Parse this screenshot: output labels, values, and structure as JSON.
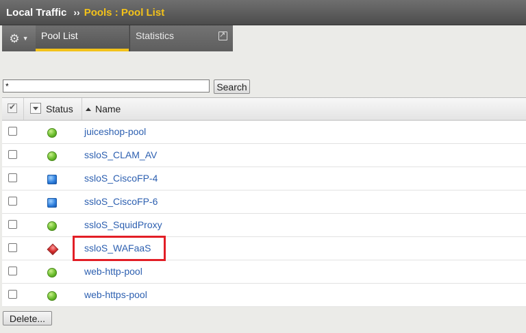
{
  "breadcrumb": {
    "section": "Local Traffic",
    "separator": "››",
    "page": "Pools : Pool List"
  },
  "tabs": {
    "options_icon": "gear-icon",
    "items": [
      {
        "label": "Pool List",
        "active": true
      },
      {
        "label": "Statistics",
        "active": false,
        "icon": "popout-icon"
      }
    ]
  },
  "search": {
    "value": "*",
    "button_label": "Search"
  },
  "table": {
    "columns": {
      "status": "Status",
      "name": "Name"
    },
    "rows": [
      {
        "name": "juiceshop-pool",
        "status": "green-circle"
      },
      {
        "name": "ssloS_CLAM_AV",
        "status": "green-circle"
      },
      {
        "name": "ssloS_CiscoFP-4",
        "status": "blue-square"
      },
      {
        "name": "ssloS_CiscoFP-6",
        "status": "blue-square"
      },
      {
        "name": "ssloS_SquidProxy",
        "status": "green-circle"
      },
      {
        "name": "ssloS_WAFaaS",
        "status": "red-diamond",
        "highlighted": true
      },
      {
        "name": "web-http-pool",
        "status": "green-circle"
      },
      {
        "name": "web-https-pool",
        "status": "green-circle"
      }
    ]
  },
  "actions": {
    "delete_label": "Delete..."
  },
  "colors": {
    "accent": "#f3c21a",
    "link": "#2c5fb0",
    "highlight": "#e21e26"
  }
}
